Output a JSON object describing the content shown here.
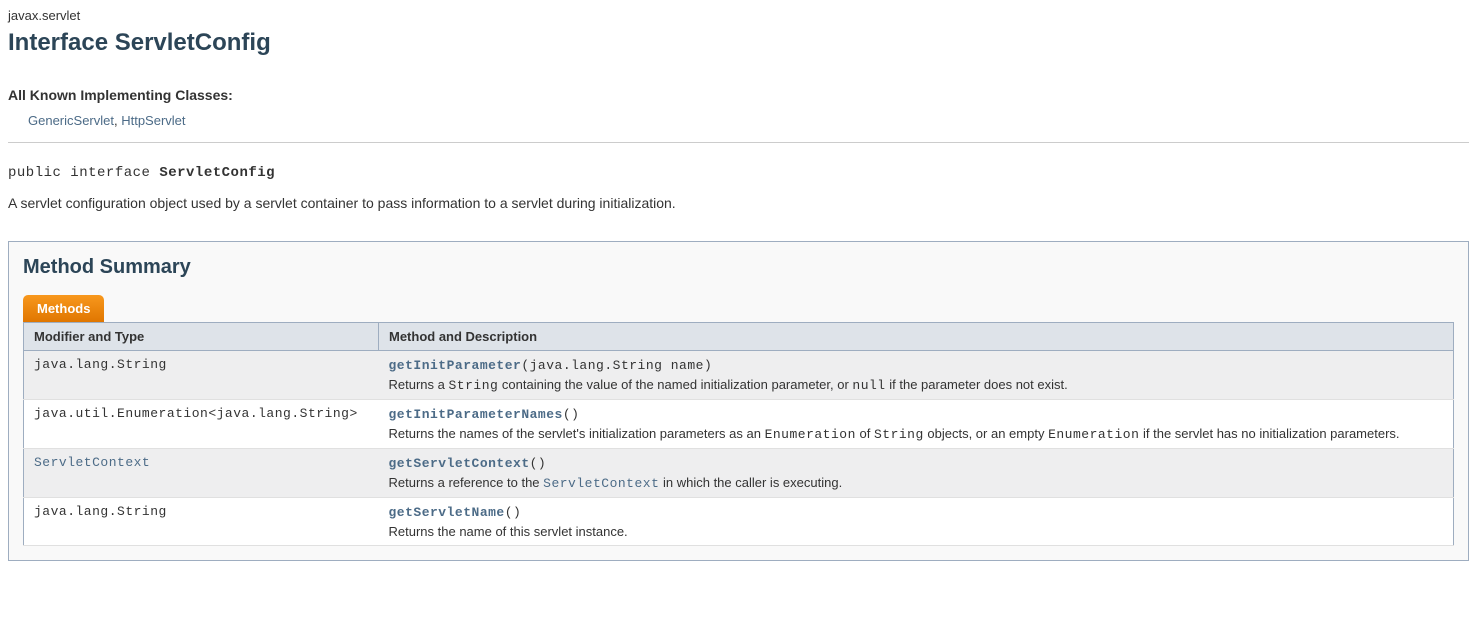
{
  "package": "javax.servlet",
  "title": "Interface ServletConfig",
  "impl_heading": "All Known Implementing Classes:",
  "impl_classes": {
    "generic": "GenericServlet",
    "sep": ", ",
    "http": "HttpServlet"
  },
  "signature": {
    "prefix": "public interface ",
    "name": "ServletConfig"
  },
  "description": "A servlet configuration object used by a servlet container to pass information to a servlet during initialization.",
  "summary_title": "Method Summary",
  "tab_label": "Methods",
  "headers": {
    "col1": "Modifier and Type",
    "col2": "Method and Description"
  },
  "methods": {
    "r0": {
      "type": "java.lang.String",
      "name": "getInitParameter",
      "params": "(java.lang.String name)",
      "desc_pre": "Returns a ",
      "code1": "String",
      "desc_mid": " containing the value of the named initialization parameter, or ",
      "code2": "null",
      "desc_post": " if the parameter does not exist."
    },
    "r1": {
      "type": "java.util.Enumeration<java.lang.String>",
      "name": "getInitParameterNames",
      "params": "()",
      "desc_pre": "Returns the names of the servlet's initialization parameters as an ",
      "code1": "Enumeration",
      "desc_mid1": " of ",
      "code2": "String",
      "desc_mid2": " objects, or an empty ",
      "code3": "Enumeration",
      "desc_post": " if the servlet has no initialization parameters."
    },
    "r2": {
      "type": "ServletContext",
      "name": "getServletContext",
      "params": "()",
      "desc_pre": "Returns a reference to the ",
      "code1": "ServletContext",
      "desc_post": " in which the caller is executing."
    },
    "r3": {
      "type": "java.lang.String",
      "name": "getServletName",
      "params": "()",
      "desc": "Returns the name of this servlet instance."
    }
  }
}
